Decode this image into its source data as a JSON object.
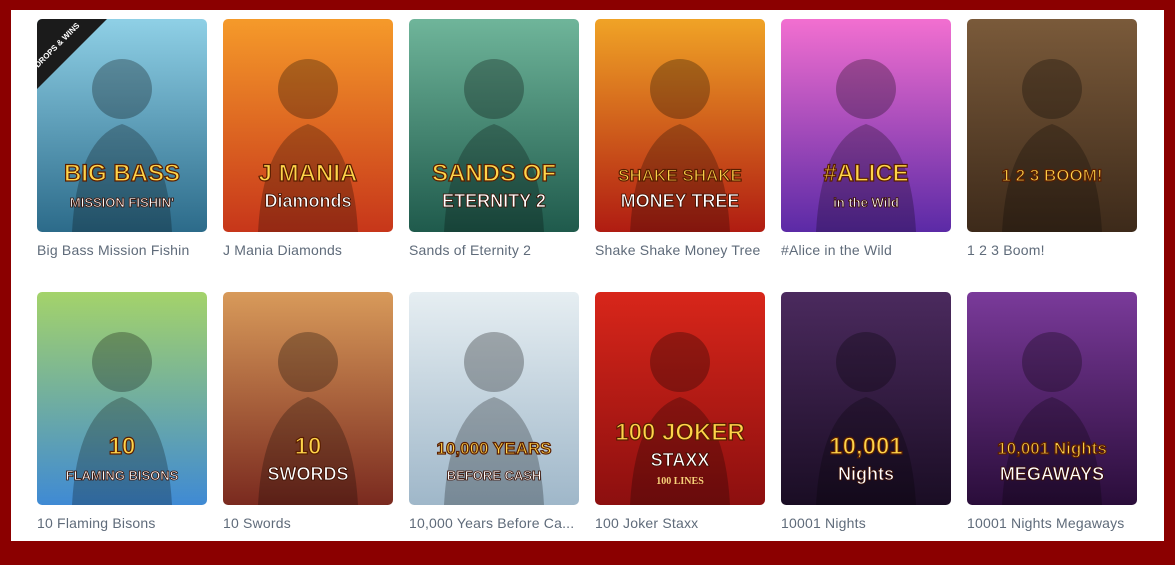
{
  "games": [
    {
      "title": "Big Bass Mission Fishin",
      "art_line1": "BIG BASS",
      "art_line2": "MISSION FISHIN'",
      "badge": "DROPS & WINS",
      "colors": [
        "#2c6b8a",
        "#8fd0e6"
      ]
    },
    {
      "title": "J Mania Diamonds",
      "art_line1": "J MANIA",
      "art_line2": "Diamonds",
      "colors": [
        "#c7361a",
        "#f59a2a"
      ]
    },
    {
      "title": "Sands of Eternity 2",
      "art_line1": "SANDS OF",
      "art_line2": "ETERNITY 2",
      "colors": [
        "#1f5a4c",
        "#6fb59a"
      ]
    },
    {
      "title": "Shake Shake Money Tree",
      "art_line1": "SHAKE SHAKE",
      "art_line2": "MONEY TREE",
      "colors": [
        "#b01c12",
        "#f0a326"
      ]
    },
    {
      "title": "#Alice in the Wild",
      "art_line1": "#ALICE",
      "art_line2": "in the Wild",
      "colors": [
        "#5b2aa6",
        "#f26fd0"
      ]
    },
    {
      "title": "1 2 3 Boom!",
      "art_line1": "1 2 3 BOOM!",
      "art_line2": "",
      "colors": [
        "#3d2a1a",
        "#7a5a3a"
      ]
    },
    {
      "title": "10 Flaming Bisons",
      "art_line1": "10",
      "art_line2": "FLAMING BISONS",
      "colors": [
        "#3f8ad4",
        "#a4d36a"
      ]
    },
    {
      "title": "10 Swords",
      "art_line1": "10",
      "art_line2": "SWORDS",
      "colors": [
        "#7a2a1f",
        "#d89a5a"
      ]
    },
    {
      "title": "10,000 Years Before Ca...",
      "art_line1": "10,000 YEARS",
      "art_line2": "BEFORE CASH",
      "colors": [
        "#9fb7c9",
        "#e6eef2"
      ]
    },
    {
      "title": "100 Joker Staxx",
      "art_line1": "100 JOKER",
      "art_line2": "STAXX",
      "art_line3": "100 LINES",
      "colors": [
        "#8c0f0f",
        "#d8261a"
      ]
    },
    {
      "title": "10001 Nights",
      "art_line1": "10,001",
      "art_line2": "Nights",
      "colors": [
        "#1a0d24",
        "#4b2a5e"
      ]
    },
    {
      "title": "10001 Nights Megaways",
      "art_line1": "10,001 Nights",
      "art_line2": "MEGAWAYS",
      "colors": [
        "#2a0d3a",
        "#7a3a9a"
      ]
    }
  ]
}
